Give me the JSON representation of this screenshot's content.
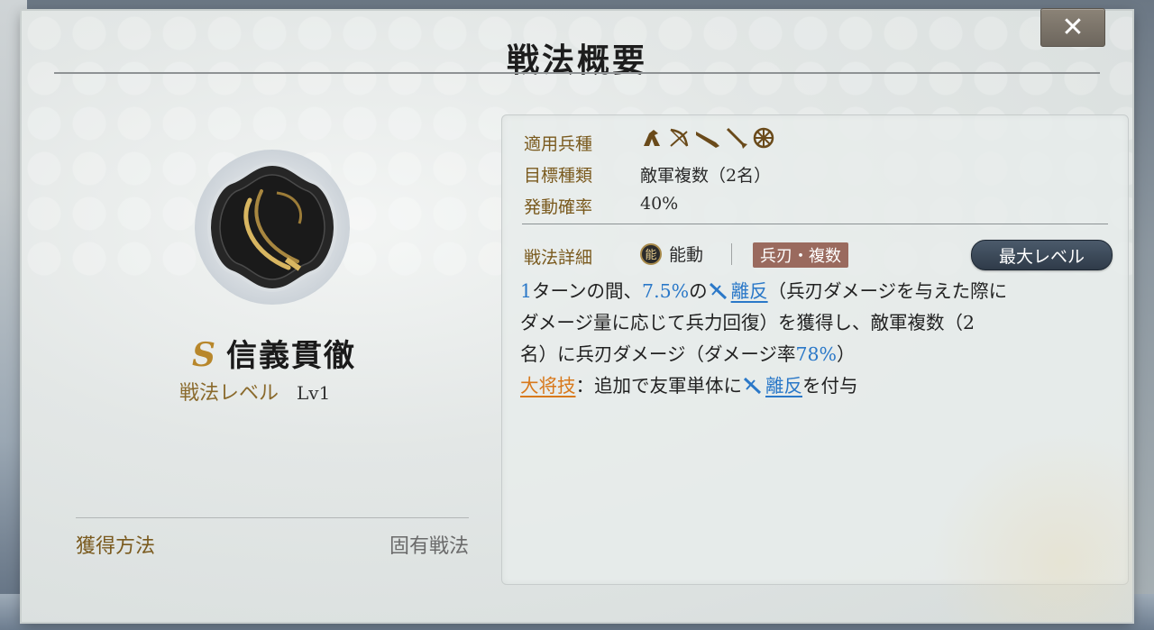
{
  "dialog": {
    "title": "戦法概要",
    "close_label": "✕"
  },
  "skill": {
    "grade": "S",
    "name": "信義貫徹",
    "level_label": "戦法レベル",
    "level_value": "Lv1",
    "acquire_label": "獲得方法",
    "acquire_value": "固有戦法",
    "icon": "crossed-swords-emblem"
  },
  "info": {
    "troops_label": "適用兵種",
    "troop_icons": [
      "cavalry-icon",
      "bow-icon",
      "gun-icon",
      "spear-icon",
      "wheel-icon"
    ],
    "target_label": "目標種類",
    "target_value": "敵軍複数（2名）",
    "rate_label": "発動確率",
    "rate_value": "40%"
  },
  "detail": {
    "label": "戦法詳細",
    "type_badge": "能",
    "type": "能動",
    "tag": "兵刃・複数",
    "max_level_button": "最大レベル",
    "desc": {
      "turns": "1",
      "t1": "ターンの間、",
      "pct1": "7.5%",
      "t2": "の",
      "link1": "離反",
      "t3": "（兵刃ダメージを与えた際に",
      "line2": "ダメージ量に応じて兵力回復）を獲得し、敵軍複数（2",
      "line3a": "名）に兵刃ダメージ（ダメージ率",
      "pct2": "78%",
      "line3b": "）",
      "general_skill": "大将技",
      "line4a": "：追加で友軍単体に",
      "link2": "離反",
      "line4b": "を付与"
    }
  },
  "colors": {
    "accent_gold": "#7a5a1e",
    "link_blue": "#2a78c8",
    "orange": "#d8791c",
    "tag_bg": "#9a6a5e"
  }
}
